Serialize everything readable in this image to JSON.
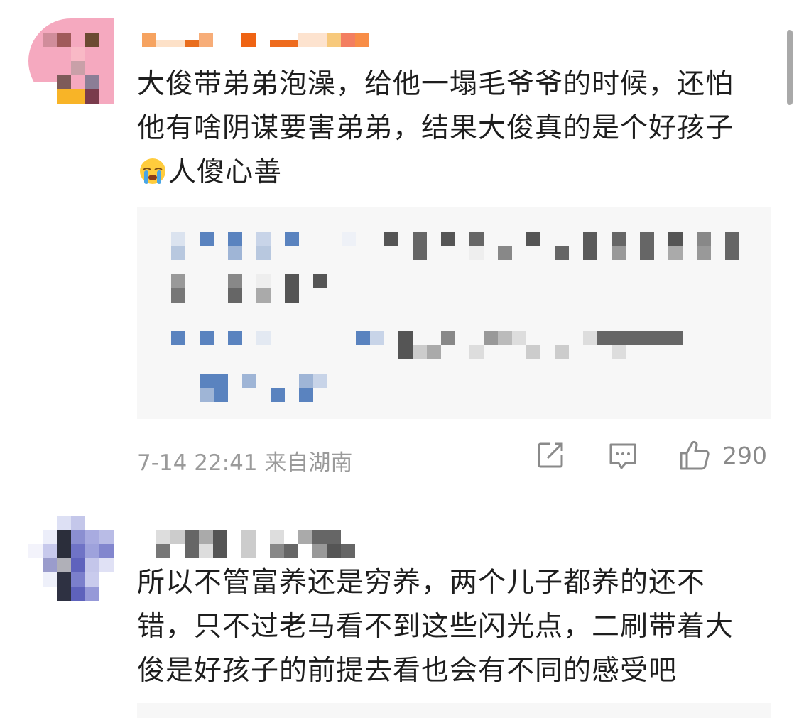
{
  "comments": [
    {
      "text": "大俊带弟弟泡澡，给他一塌毛爷爷的时候，还怕他有啥阴谋要害弟弟，结果大俊真的是个好孩子",
      "emoji": "loudly-crying-face-emoji",
      "text_after_emoji": "人傻心善",
      "meta": "7-14 22:41 来自湖南",
      "like_count": "290",
      "actions": [
        "share-icon",
        "comment-icon",
        "like-icon"
      ]
    },
    {
      "text": "所以不管富养还是穷养，两个儿子都养的还不错，只不过老马看不到这些闪光点，二刷带着大俊是好孩子的前提去看也会有不同的感受吧"
    }
  ],
  "colors": {
    "text": "#1e1e1e",
    "meta": "#9a9a9a",
    "quote_bg": "#f7f7f7",
    "link_blue": "#4f79b8",
    "pixel_gray": "#555555"
  }
}
